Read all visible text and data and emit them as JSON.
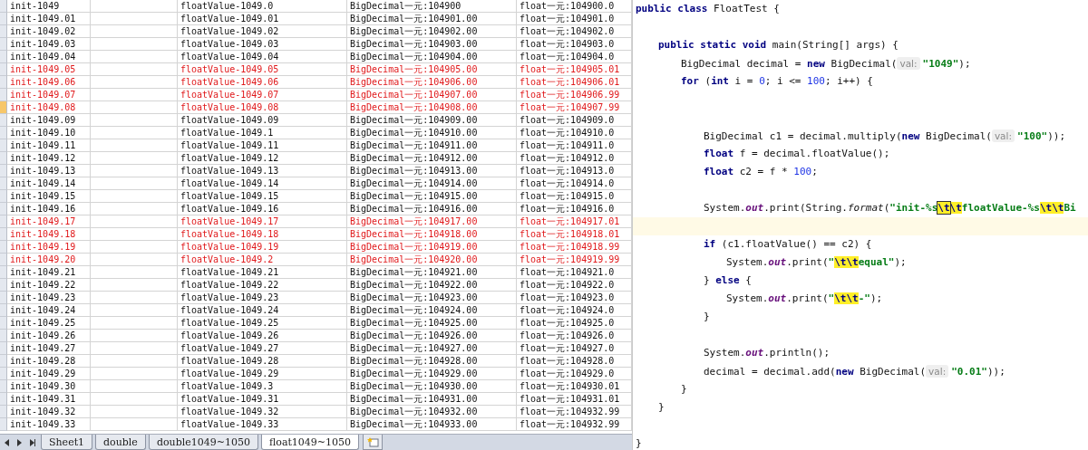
{
  "sheet": {
    "rows": [
      {
        "cells": [
          "init-1049",
          "floatValue-1049.0",
          "BigDecimal一元:104900",
          "float一元:104900.0"
        ],
        "flagged": false,
        "selected": false
      },
      {
        "cells": [
          "init-1049.01",
          "floatValue-1049.01",
          "BigDecimal一元:104901.00",
          "float一元:104901.0"
        ],
        "flagged": false,
        "selected": false
      },
      {
        "cells": [
          "init-1049.02",
          "floatValue-1049.02",
          "BigDecimal一元:104902.00",
          "float一元:104902.0"
        ],
        "flagged": false,
        "selected": false
      },
      {
        "cells": [
          "init-1049.03",
          "floatValue-1049.03",
          "BigDecimal一元:104903.00",
          "float一元:104903.0"
        ],
        "flagged": false,
        "selected": false
      },
      {
        "cells": [
          "init-1049.04",
          "floatValue-1049.04",
          "BigDecimal一元:104904.00",
          "float一元:104904.0"
        ],
        "flagged": false,
        "selected": false
      },
      {
        "cells": [
          "init-1049.05",
          "floatValue-1049.05",
          "BigDecimal一元:104905.00",
          "float一元:104905.01"
        ],
        "flagged": true,
        "selected": false
      },
      {
        "cells": [
          "init-1049.06",
          "floatValue-1049.06",
          "BigDecimal一元:104906.00",
          "float一元:104906.01"
        ],
        "flagged": true,
        "selected": false
      },
      {
        "cells": [
          "init-1049.07",
          "floatValue-1049.07",
          "BigDecimal一元:104907.00",
          "float一元:104906.99"
        ],
        "flagged": true,
        "selected": false
      },
      {
        "cells": [
          "init-1049.08",
          "floatValue-1049.08",
          "BigDecimal一元:104908.00",
          "float一元:104907.99"
        ],
        "flagged": true,
        "selected": true
      },
      {
        "cells": [
          "init-1049.09",
          "floatValue-1049.09",
          "BigDecimal一元:104909.00",
          "float一元:104909.0"
        ],
        "flagged": false,
        "selected": false
      },
      {
        "cells": [
          "init-1049.10",
          "floatValue-1049.1",
          "BigDecimal一元:104910.00",
          "float一元:104910.0"
        ],
        "flagged": false,
        "selected": false
      },
      {
        "cells": [
          "init-1049.11",
          "floatValue-1049.11",
          "BigDecimal一元:104911.00",
          "float一元:104911.0"
        ],
        "flagged": false,
        "selected": false
      },
      {
        "cells": [
          "init-1049.12",
          "floatValue-1049.12",
          "BigDecimal一元:104912.00",
          "float一元:104912.0"
        ],
        "flagged": false,
        "selected": false
      },
      {
        "cells": [
          "init-1049.13",
          "floatValue-1049.13",
          "BigDecimal一元:104913.00",
          "float一元:104913.0"
        ],
        "flagged": false,
        "selected": false
      },
      {
        "cells": [
          "init-1049.14",
          "floatValue-1049.14",
          "BigDecimal一元:104914.00",
          "float一元:104914.0"
        ],
        "flagged": false,
        "selected": false
      },
      {
        "cells": [
          "init-1049.15",
          "floatValue-1049.15",
          "BigDecimal一元:104915.00",
          "float一元:104915.0"
        ],
        "flagged": false,
        "selected": false
      },
      {
        "cells": [
          "init-1049.16",
          "floatValue-1049.16",
          "BigDecimal一元:104916.00",
          "float一元:104916.0"
        ],
        "flagged": false,
        "selected": false
      },
      {
        "cells": [
          "init-1049.17",
          "floatValue-1049.17",
          "BigDecimal一元:104917.00",
          "float一元:104917.01"
        ],
        "flagged": true,
        "selected": false
      },
      {
        "cells": [
          "init-1049.18",
          "floatValue-1049.18",
          "BigDecimal一元:104918.00",
          "float一元:104918.01"
        ],
        "flagged": true,
        "selected": false
      },
      {
        "cells": [
          "init-1049.19",
          "floatValue-1049.19",
          "BigDecimal一元:104919.00",
          "float一元:104918.99"
        ],
        "flagged": true,
        "selected": false
      },
      {
        "cells": [
          "init-1049.20",
          "floatValue-1049.2",
          "BigDecimal一元:104920.00",
          "float一元:104919.99"
        ],
        "flagged": true,
        "selected": false
      },
      {
        "cells": [
          "init-1049.21",
          "floatValue-1049.21",
          "BigDecimal一元:104921.00",
          "float一元:104921.0"
        ],
        "flagged": false,
        "selected": false
      },
      {
        "cells": [
          "init-1049.22",
          "floatValue-1049.22",
          "BigDecimal一元:104922.00",
          "float一元:104922.0"
        ],
        "flagged": false,
        "selected": false
      },
      {
        "cells": [
          "init-1049.23",
          "floatValue-1049.23",
          "BigDecimal一元:104923.00",
          "float一元:104923.0"
        ],
        "flagged": false,
        "selected": false
      },
      {
        "cells": [
          "init-1049.24",
          "floatValue-1049.24",
          "BigDecimal一元:104924.00",
          "float一元:104924.0"
        ],
        "flagged": false,
        "selected": false
      },
      {
        "cells": [
          "init-1049.25",
          "floatValue-1049.25",
          "BigDecimal一元:104925.00",
          "float一元:104925.0"
        ],
        "flagged": false,
        "selected": false
      },
      {
        "cells": [
          "init-1049.26",
          "floatValue-1049.26",
          "BigDecimal一元:104926.00",
          "float一元:104926.0"
        ],
        "flagged": false,
        "selected": false
      },
      {
        "cells": [
          "init-1049.27",
          "floatValue-1049.27",
          "BigDecimal一元:104927.00",
          "float一元:104927.0"
        ],
        "flagged": false,
        "selected": false
      },
      {
        "cells": [
          "init-1049.28",
          "floatValue-1049.28",
          "BigDecimal一元:104928.00",
          "float一元:104928.0"
        ],
        "flagged": false,
        "selected": false
      },
      {
        "cells": [
          "init-1049.29",
          "floatValue-1049.29",
          "BigDecimal一元:104929.00",
          "float一元:104929.0"
        ],
        "flagged": false,
        "selected": false
      },
      {
        "cells": [
          "init-1049.30",
          "floatValue-1049.3",
          "BigDecimal一元:104930.00",
          "float一元:104930.01"
        ],
        "flagged": false,
        "selected": false
      },
      {
        "cells": [
          "init-1049.31",
          "floatValue-1049.31",
          "BigDecimal一元:104931.00",
          "float一元:104931.01"
        ],
        "flagged": false,
        "selected": false
      },
      {
        "cells": [
          "init-1049.32",
          "floatValue-1049.32",
          "BigDecimal一元:104932.00",
          "float一元:104932.99"
        ],
        "flagged": false,
        "selected": false
      },
      {
        "cells": [
          "init-1049.33",
          "floatValue-1049.33",
          "BigDecimal一元:104933.00",
          "float一元:104932.99"
        ],
        "flagged": false,
        "selected": false
      }
    ],
    "tabs": [
      {
        "label": "Sheet1",
        "selected": false
      },
      {
        "label": "double",
        "selected": false
      },
      {
        "label": "double1049~1050",
        "selected": false
      },
      {
        "label": "float1049~1050",
        "selected": true
      }
    ]
  },
  "editor": {
    "lines": [
      {
        "current": false,
        "tokens": [
          {
            "kind": "kw",
            "text": "public class"
          },
          {
            "kind": "plain",
            "text": " FloatTest {"
          }
        ],
        "children": [
          {
            "current": false
          },
          {
            "current": false,
            "tokens": [
              {
                "kind": "kw",
                "text": "public static void"
              },
              {
                "kind": "plain",
                "text": " main(String[] args) {"
              }
            ],
            "children": [
              {
                "current": false,
                "tokens": [
                  {
                    "kind": "plain",
                    "text": "BigDecimal decimal = "
                  },
                  {
                    "kind": "kw",
                    "text": "new"
                  },
                  {
                    "kind": "plain",
                    "text": " BigDecimal("
                  },
                  {
                    "kind": "hint",
                    "text": "val:"
                  },
                  {
                    "kind": "str",
                    "text": "\"1049\""
                  },
                  {
                    "kind": "plain",
                    "text": ");"
                  }
                ]
              },
              {
                "current": false,
                "tokens": [
                  {
                    "kind": "kw",
                    "text": "for"
                  },
                  {
                    "kind": "plain",
                    "text": " ("
                  },
                  {
                    "kind": "kw",
                    "text": "int"
                  },
                  {
                    "kind": "plain",
                    "text": " i = "
                  },
                  {
                    "kind": "num",
                    "text": "0"
                  },
                  {
                    "kind": "plain",
                    "text": "; i <= "
                  },
                  {
                    "kind": "num",
                    "text": "100"
                  },
                  {
                    "kind": "plain",
                    "text": "; i++) {"
                  }
                ],
                "children": [
                  {
                    "current": false
                  },
                  {
                    "current": false
                  },
                  {
                    "current": false,
                    "tokens": [
                      {
                        "kind": "plain",
                        "text": "BigDecimal c1 = decimal.multiply("
                      },
                      {
                        "kind": "kw",
                        "text": "new"
                      },
                      {
                        "kind": "plain",
                        "text": " BigDecimal("
                      },
                      {
                        "kind": "hint",
                        "text": "val:"
                      },
                      {
                        "kind": "str",
                        "text": "\"100\""
                      },
                      {
                        "kind": "plain",
                        "text": "));"
                      }
                    ]
                  },
                  {
                    "current": false,
                    "tokens": [
                      {
                        "kind": "kw",
                        "text": "float"
                      },
                      {
                        "kind": "plain",
                        "text": " f = decimal.floatValue();"
                      }
                    ]
                  },
                  {
                    "current": false,
                    "tokens": [
                      {
                        "kind": "kw",
                        "text": "float"
                      },
                      {
                        "kind": "plain",
                        "text": " c2 = f * "
                      },
                      {
                        "kind": "num",
                        "text": "100"
                      },
                      {
                        "kind": "plain",
                        "text": ";"
                      }
                    ]
                  },
                  {
                    "current": false
                  },
                  {
                    "current": false,
                    "tokens": [
                      {
                        "kind": "plain",
                        "text": "System."
                      },
                      {
                        "kind": "field",
                        "text": "out"
                      },
                      {
                        "kind": "plain",
                        "text": ".print(String."
                      },
                      {
                        "kind": "method",
                        "text": "format"
                      },
                      {
                        "kind": "plain",
                        "text": "("
                      },
                      {
                        "kind": "str",
                        "text": "\"init-%s"
                      },
                      {
                        "kind": "escbox",
                        "text": "\\t"
                      },
                      {
                        "kind": "esc",
                        "text": "\\t"
                      },
                      {
                        "kind": "str",
                        "text": "floatValue-%s"
                      },
                      {
                        "kind": "esc",
                        "text": "\\t\\t"
                      },
                      {
                        "kind": "str",
                        "text": "Bi"
                      }
                    ]
                  },
                  {
                    "current": true
                  },
                  {
                    "current": false,
                    "tokens": [
                      {
                        "kind": "kw",
                        "text": "if"
                      },
                      {
                        "kind": "plain",
                        "text": " (c1.floatValue() == c2) {"
                      }
                    ],
                    "children": [
                      {
                        "current": false,
                        "tokens": [
                          {
                            "kind": "plain",
                            "text": "System."
                          },
                          {
                            "kind": "field",
                            "text": "out"
                          },
                          {
                            "kind": "plain",
                            "text": ".print("
                          },
                          {
                            "kind": "str",
                            "text": "\""
                          },
                          {
                            "kind": "esc",
                            "text": "\\t\\t"
                          },
                          {
                            "kind": "str",
                            "text": "equal\""
                          },
                          {
                            "kind": "plain",
                            "text": ");"
                          }
                        ]
                      }
                    ]
                  },
                  {
                    "current": false,
                    "tokens": [
                      {
                        "kind": "plain",
                        "text": "} "
                      },
                      {
                        "kind": "kw",
                        "text": "else"
                      },
                      {
                        "kind": "plain",
                        "text": " {"
                      }
                    ],
                    "children": [
                      {
                        "current": false,
                        "tokens": [
                          {
                            "kind": "plain",
                            "text": "System."
                          },
                          {
                            "kind": "field",
                            "text": "out"
                          },
                          {
                            "kind": "plain",
                            "text": ".print("
                          },
                          {
                            "kind": "str",
                            "text": "\""
                          },
                          {
                            "kind": "esc",
                            "text": "\\t\\t"
                          },
                          {
                            "kind": "str",
                            "text": "-\""
                          },
                          {
                            "kind": "plain",
                            "text": ");"
                          }
                        ]
                      }
                    ]
                  },
                  {
                    "current": false,
                    "tokens": [
                      {
                        "kind": "plain",
                        "text": "}"
                      }
                    ]
                  },
                  {
                    "current": false
                  },
                  {
                    "current": false,
                    "tokens": [
                      {
                        "kind": "plain",
                        "text": "System."
                      },
                      {
                        "kind": "field",
                        "text": "out"
                      },
                      {
                        "kind": "plain",
                        "text": ".println();"
                      }
                    ]
                  },
                  {
                    "current": false,
                    "tokens": [
                      {
                        "kind": "plain",
                        "text": "decimal = decimal.add("
                      },
                      {
                        "kind": "kw",
                        "text": "new"
                      },
                      {
                        "kind": "plain",
                        "text": " BigDecimal("
                      },
                      {
                        "kind": "hint",
                        "text": "val:"
                      },
                      {
                        "kind": "str",
                        "text": "\"0.01\""
                      },
                      {
                        "kind": "plain",
                        "text": "));"
                      }
                    ]
                  }
                ]
              },
              {
                "current": false,
                "tokens": [
                  {
                    "kind": "plain",
                    "text": "}"
                  }
                ]
              }
            ]
          },
          {
            "current": false,
            "tokens": [
              {
                "kind": "plain",
                "text": "}"
              }
            ]
          }
        ]
      },
      {
        "current": false
      },
      {
        "current": false,
        "tokens": [
          {
            "kind": "plain",
            "text": "}"
          }
        ]
      }
    ]
  }
}
